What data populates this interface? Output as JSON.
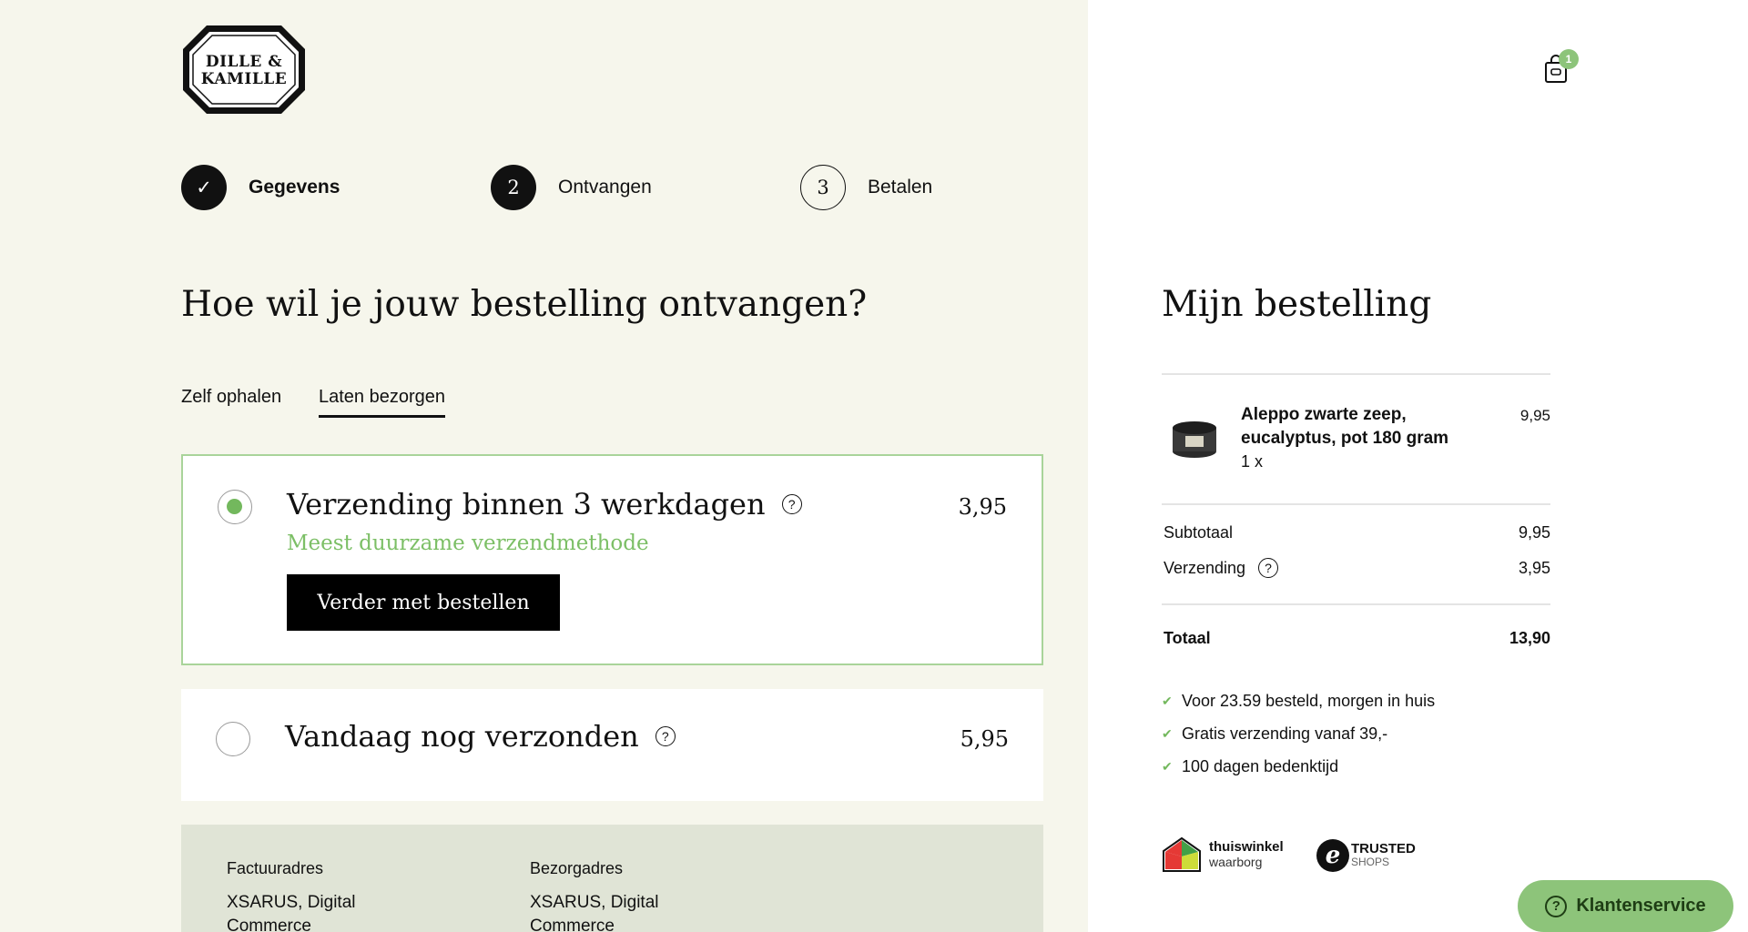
{
  "brand": {
    "logo_text": "DILLE &\nKAMILLE"
  },
  "cart": {
    "count": "1"
  },
  "steps": [
    {
      "number": "✓",
      "label": "Gegevens",
      "state": "done"
    },
    {
      "number": "2",
      "label": "Ontvangen",
      "state": "current"
    },
    {
      "number": "3",
      "label": "Betalen",
      "state": "upcoming"
    }
  ],
  "main": {
    "heading": "Hoe wil je jouw bestelling ontvangen?",
    "tabs": [
      {
        "label": "Zelf ophalen",
        "active": false
      },
      {
        "label": "Laten bezorgen",
        "active": true
      }
    ],
    "options": [
      {
        "title": "Verzending binnen 3 werkdagen",
        "price": "3,95",
        "subtitle": "Meest duurzame verzendmethode",
        "selected": true,
        "button": "Verder met bestellen"
      },
      {
        "title": "Vandaag nog verzonden",
        "price": "5,95",
        "selected": false
      }
    ],
    "address": {
      "billing_label": "Factuuradres",
      "billing_value": "XSARUS, Digital Commerce",
      "delivery_label": "Bezorgadres",
      "delivery_value": "XSARUS, Digital Commerce"
    }
  },
  "order": {
    "heading": "Mijn bestelling",
    "item": {
      "name": "Aleppo zwarte zeep, eucalyptus, pot 180 gram",
      "qty": "1 x",
      "price": "9,95"
    },
    "subtotal_label": "Subtotaal",
    "subtotal_value": "9,95",
    "shipping_label": "Verzending",
    "shipping_value": "3,95",
    "total_label": "Totaal",
    "total_value": "13,90",
    "usps": [
      "Voor 23.59 besteld, morgen in huis",
      "Gratis verzending vanaf 39,-",
      "100 dagen bedenktijd"
    ],
    "trust": {
      "thuiswinkel_1": "thuiswinkel",
      "thuiswinkel_2": "waarborg",
      "shops_1": "TRUSTED",
      "shops_2": "SHOPS"
    }
  },
  "service_button": "Klantenservice",
  "colors": {
    "left_background": "#f6f6ec",
    "accent_green": "#73b85d",
    "selected_border": "#a9d49a",
    "address_panel": "#e0e4d6",
    "service_button": "#8dc47a"
  }
}
